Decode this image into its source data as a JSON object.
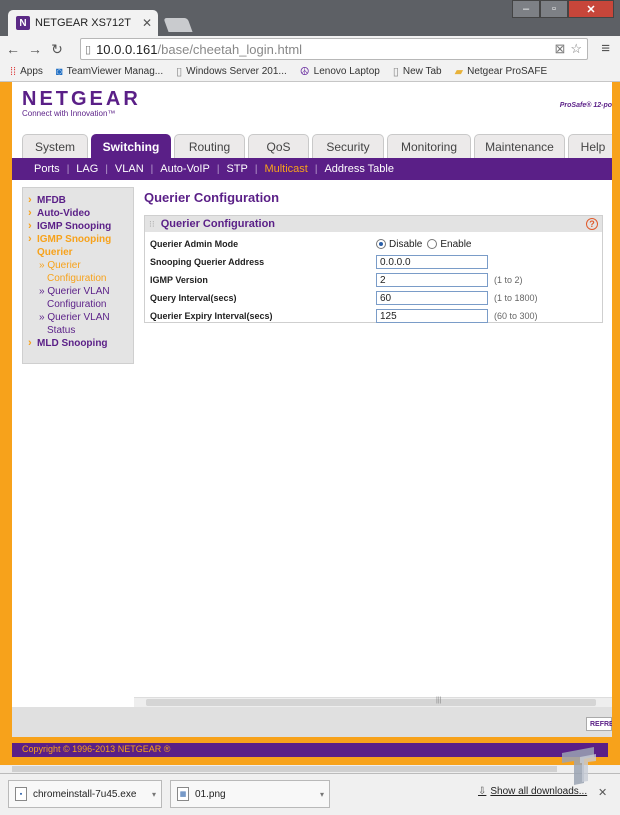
{
  "browser": {
    "tab_title": "NETGEAR XS712T",
    "tab_favicon": "N",
    "url_host": "10.0.0.161",
    "url_path": "/base/cheetah_login.html",
    "bookmarks": [
      {
        "label": "Apps",
        "icon": "apps-grid-icon"
      },
      {
        "label": "TeamViewer Manag...",
        "icon": "teamviewer-icon"
      },
      {
        "label": "Windows Server 201...",
        "icon": "page-icon"
      },
      {
        "label": "Lenovo Laptop",
        "icon": "peace-icon"
      },
      {
        "label": "New Tab",
        "icon": "page-icon"
      },
      {
        "label": "Netgear ProSAFE",
        "icon": "folder-icon"
      }
    ]
  },
  "header": {
    "logo": "NETGEAR",
    "tagline": "Connect with Innovation™",
    "product": "ProSafe® 12-po"
  },
  "menu": {
    "tabs": [
      {
        "label": "System",
        "active": false
      },
      {
        "label": "Switching",
        "active": true
      },
      {
        "label": "Routing",
        "active": false
      },
      {
        "label": "QoS",
        "active": false
      },
      {
        "label": "Security",
        "active": false
      },
      {
        "label": "Monitoring",
        "active": false
      },
      {
        "label": "Maintenance",
        "active": false
      },
      {
        "label": "Help",
        "active": false
      }
    ],
    "subtabs": [
      {
        "label": "Ports",
        "active": false
      },
      {
        "label": "LAG",
        "active": false
      },
      {
        "label": "VLAN",
        "active": false
      },
      {
        "label": "Auto-VoIP",
        "active": false
      },
      {
        "label": "STP",
        "active": false
      },
      {
        "label": "Multicast",
        "active": true
      },
      {
        "label": "Address Table",
        "active": false
      }
    ]
  },
  "leftnav": {
    "mfdb": "MFDB",
    "auto_video": "Auto-Video",
    "igmp_snooping": "IGMP Snooping",
    "igmp_snooping_querier": "IGMP Snooping Querier",
    "querier_config": "» Querier Configuration",
    "querier_vlan_config": "» Querier VLAN Configuration",
    "querier_vlan_status": "» Querier VLAN Status",
    "mld_snooping": "MLD Snooping"
  },
  "content": {
    "page_title": "Querier Configuration",
    "panel_title": "Querier Configuration",
    "help_glyph": "?",
    "admin_mode_label": "Querier Admin Mode",
    "admin_mode_options": [
      "Disable",
      "Enable"
    ],
    "admin_mode_selected": "Disable",
    "snoop_addr_label": "Snooping Querier Address",
    "snoop_addr_value": "0.0.0.0",
    "igmp_version_label": "IGMP Version",
    "igmp_version_value": "2",
    "igmp_version_hint": "(1 to 2)",
    "query_interval_label": "Query Interval(secs)",
    "query_interval_value": "60",
    "query_interval_hint": "(1 to 1800)",
    "expiry_label": "Querier Expiry Interval(secs)",
    "expiry_value": "125",
    "expiry_hint": "(60 to 300)"
  },
  "actions": {
    "refresh": "REFRE"
  },
  "footer": {
    "copyright": "Copyright © 1996-2013 NETGEAR ®"
  },
  "downloads": {
    "items": [
      {
        "name": "chromeinstall-7u45.exe"
      },
      {
        "name": "01.png"
      }
    ],
    "show_all": "Show all downloads..."
  },
  "colors": {
    "brand_purple": "#5a1f87",
    "accent_orange": "#f7a21b"
  }
}
